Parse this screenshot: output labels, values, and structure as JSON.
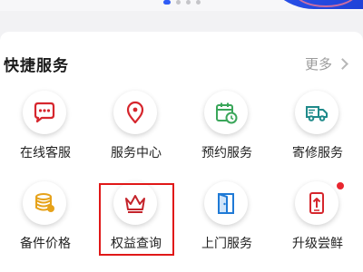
{
  "carousel": {
    "dot_count": 4,
    "active_index": 0
  },
  "quick_services": {
    "title": "快捷服务",
    "more_label": "更多"
  },
  "services": [
    {
      "label": "在线客服",
      "icon": "chat-bubble-icon",
      "color": "#d6262d"
    },
    {
      "label": "服务中心",
      "icon": "location-pin-icon",
      "color": "#d6262d"
    },
    {
      "label": "预约服务",
      "icon": "calendar-clock-icon",
      "color": "#3aa65a"
    },
    {
      "label": "寄修服务",
      "icon": "delivery-truck-icon",
      "color": "#1f8a8a"
    },
    {
      "label": "备件价格",
      "icon": "coin-stack-icon",
      "color": "#e6a21a"
    },
    {
      "label": "权益查询",
      "icon": "crown-icon",
      "color": "#c4232a",
      "highlighted": true
    },
    {
      "label": "上门服务",
      "icon": "door-icon",
      "color": "#1f7ad6"
    },
    {
      "label": "升级尝鲜",
      "icon": "upgrade-phone-icon",
      "color": "#d6262d",
      "badge": true
    }
  ]
}
